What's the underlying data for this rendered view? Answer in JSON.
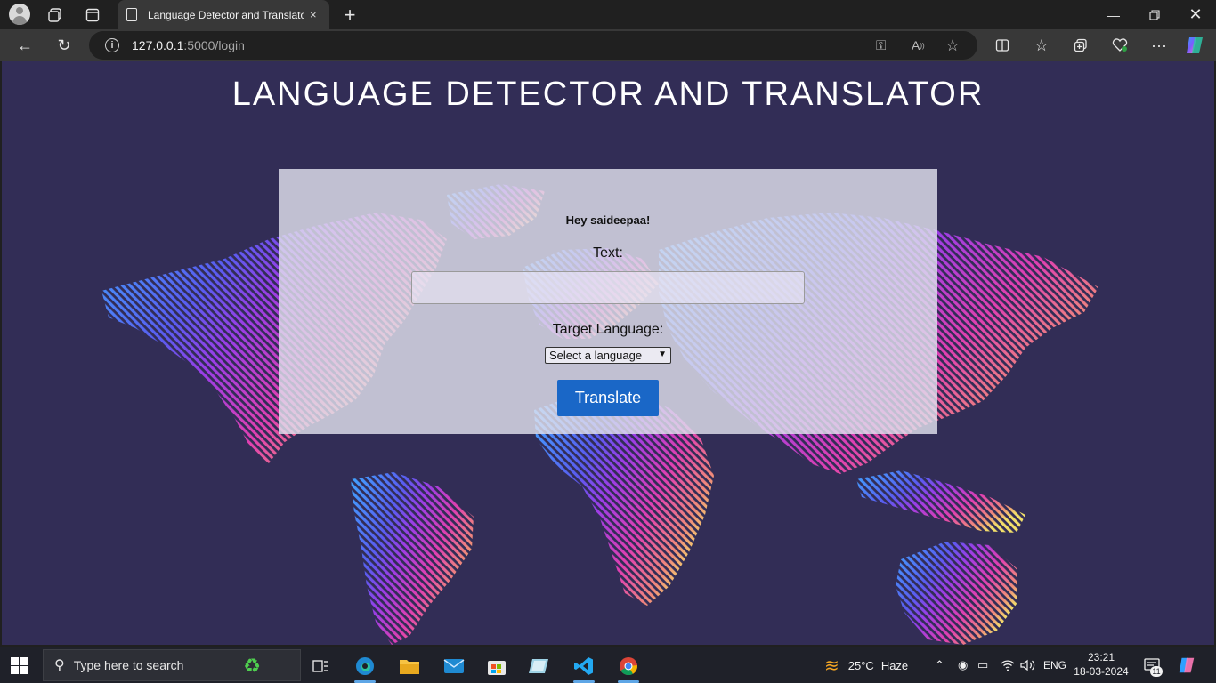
{
  "browser": {
    "tab_title": "Language Detector and Translato",
    "tab_close": "×",
    "new_tab": "+",
    "url_host": "127.0.0.1",
    "url_path": ":5000/login"
  },
  "page": {
    "title": "LANGUAGE DETECTOR AND TRANSLATOR",
    "greeting": "Hey saideepaa!",
    "text_label": "Text:",
    "text_value": "",
    "target_label": "Target Language:",
    "select_value": "Select a language",
    "translate_button": "Translate"
  },
  "taskbar": {
    "search_placeholder": "Type here to search",
    "weather_temp": "25°C",
    "weather_desc": "Haze",
    "language": "ENG",
    "time": "23:21",
    "date": "18-03-2024",
    "notification_count": "11"
  },
  "colors": {
    "page_bg": "#322d56",
    "button": "#1a67c7",
    "card": "#e1e1ee"
  }
}
